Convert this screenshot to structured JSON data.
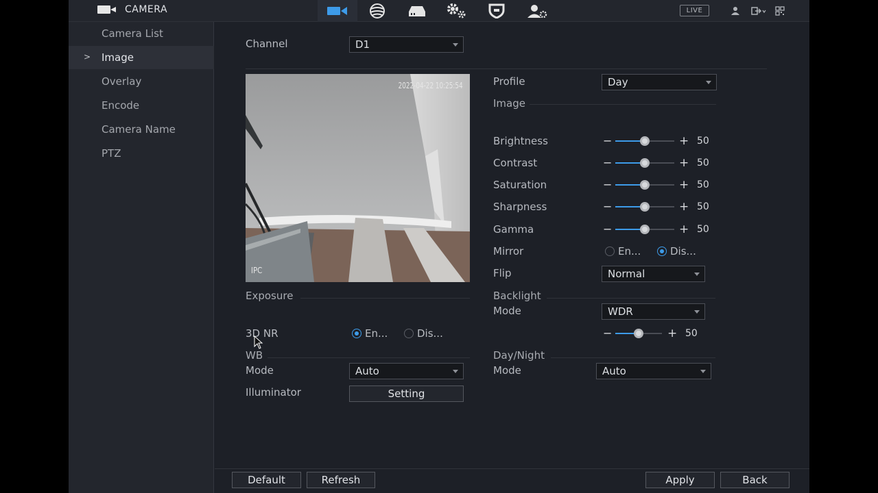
{
  "header": {
    "title": "CAMERA",
    "nav_icons": [
      "camera-icon",
      "network-icon",
      "storage-icon",
      "settings-icon",
      "security-icon",
      "account-icon"
    ],
    "live_label": "LIVE"
  },
  "sidebar": {
    "items": [
      {
        "label": "Camera List"
      },
      {
        "label": "Image",
        "active": true
      },
      {
        "label": "Overlay"
      },
      {
        "label": "Encode"
      },
      {
        "label": "Camera Name"
      },
      {
        "label": "PTZ"
      }
    ]
  },
  "channel": {
    "label": "Channel",
    "value": "D1"
  },
  "preview": {
    "timestamp": "2022-04-22 10:25:54",
    "watermark": "IPC"
  },
  "profile": {
    "label": "Profile",
    "value": "Day"
  },
  "image_section": {
    "title": "Image",
    "sliders": [
      {
        "label": "Brightness",
        "value": 50
      },
      {
        "label": "Contrast",
        "value": 50
      },
      {
        "label": "Saturation",
        "value": 50
      },
      {
        "label": "Sharpness",
        "value": 50
      },
      {
        "label": "Gamma",
        "value": 50
      }
    ],
    "mirror": {
      "label": "Mirror",
      "options": [
        "En...",
        "Dis..."
      ],
      "selected": "Dis..."
    },
    "flip": {
      "label": "Flip",
      "value": "Normal"
    }
  },
  "exposure": {
    "title": "Exposure"
  },
  "nr3d": {
    "label": "3D NR",
    "options": [
      "En...",
      "Dis..."
    ],
    "selected": "En..."
  },
  "wb": {
    "title": "WB",
    "mode_label": "Mode",
    "mode_value": "Auto"
  },
  "illuminator": {
    "label": "Illuminator",
    "button": "Setting"
  },
  "backlight": {
    "title": "Backlight",
    "mode_label": "Mode",
    "mode_value": "WDR",
    "level": 50
  },
  "daynight": {
    "title": "Day/Night",
    "mode_label": "Mode",
    "mode_value": "Auto"
  },
  "footer": {
    "default": "Default",
    "refresh": "Refresh",
    "apply": "Apply",
    "back": "Back"
  },
  "colors": {
    "accent": "#3d9be9",
    "panel": "#1d2027",
    "sidebar": "#23262d"
  }
}
